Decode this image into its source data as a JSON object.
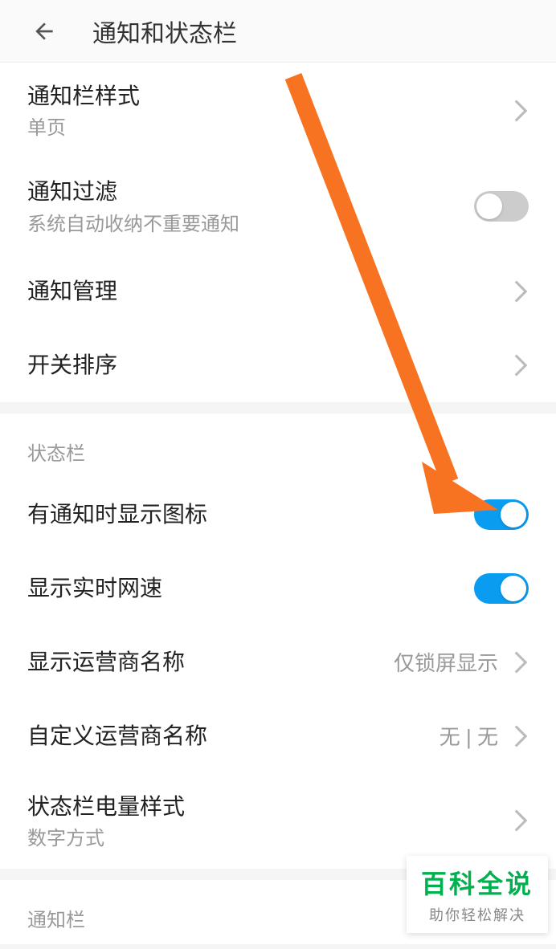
{
  "header": {
    "title": "通知和状态栏"
  },
  "section1": {
    "rows": [
      {
        "title": "通知栏样式",
        "subtitle": "单页"
      },
      {
        "title": "通知过滤",
        "subtitle": "系统自动收纳不重要通知",
        "toggle": false
      },
      {
        "title": "通知管理"
      },
      {
        "title": "开关排序"
      }
    ]
  },
  "section2": {
    "header": "状态栏",
    "rows": [
      {
        "title": "有通知时显示图标",
        "toggle": true
      },
      {
        "title": "显示实时网速",
        "toggle": true
      },
      {
        "title": "显示运营商名称",
        "value": "仅锁屏显示"
      },
      {
        "title": "自定义运营商名称",
        "value": "无 | 无"
      },
      {
        "title": "状态栏电量样式",
        "subtitle": "数字方式"
      }
    ]
  },
  "section3": {
    "header": "通知栏"
  },
  "watermark": {
    "title": "百科全说",
    "subtitle": "助你轻松解决"
  },
  "colors": {
    "accent": "#0a9cf0",
    "arrow": "#f77321",
    "brand": "#00b14f"
  }
}
